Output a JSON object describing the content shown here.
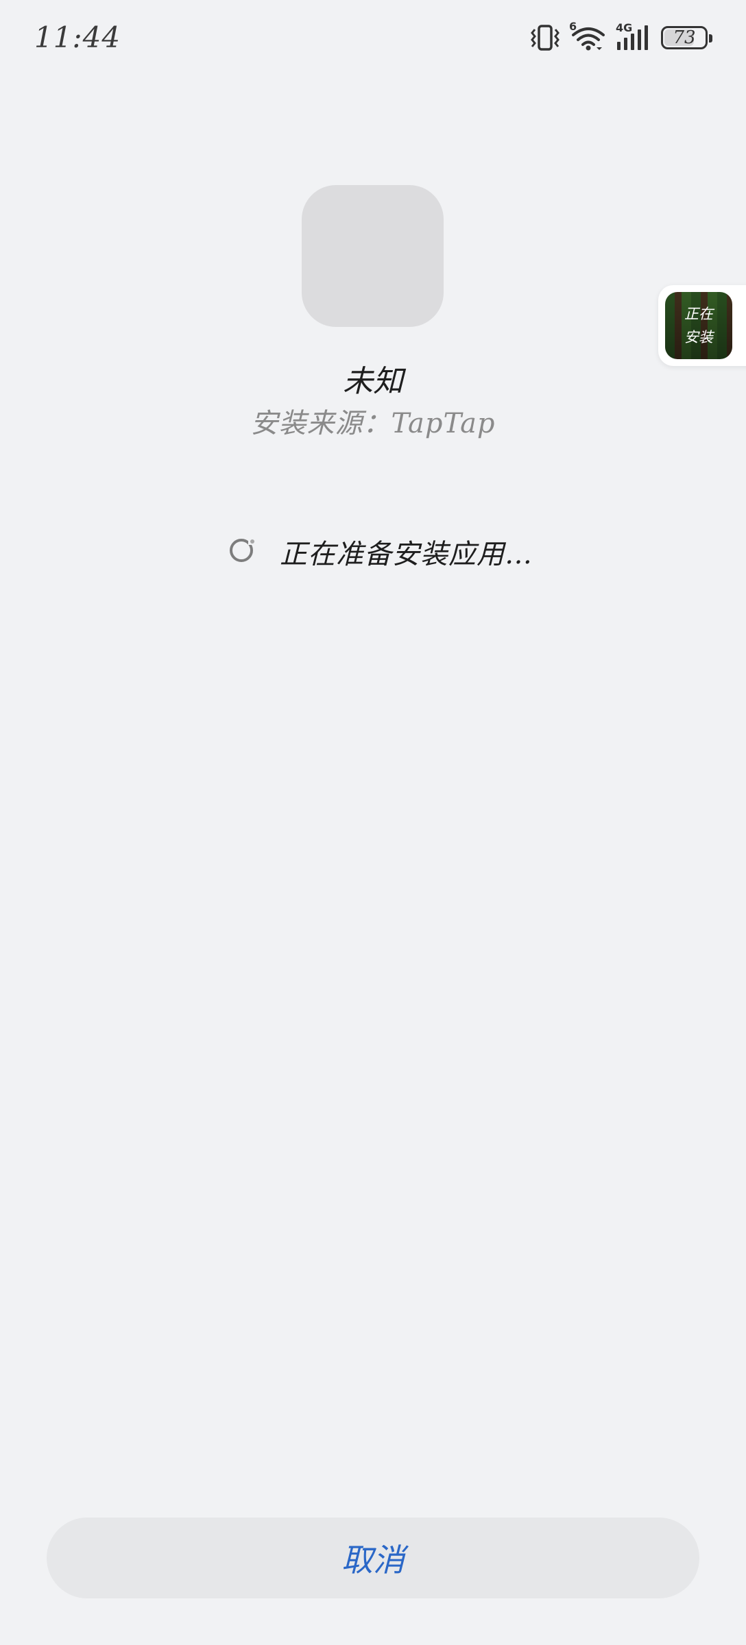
{
  "status_bar": {
    "time": "11:44",
    "network_type": "4G",
    "wifi_tag": "6",
    "battery_level": "73",
    "icons": [
      "vibrate-icon",
      "wifi-6-icon",
      "signal-4g-icon",
      "battery-icon"
    ]
  },
  "app": {
    "name": "未知",
    "install_source": "安装来源：TapTap"
  },
  "progress": {
    "message": "正在准备安装应用…"
  },
  "floating_badge": {
    "line1": "正在",
    "line2": "安装"
  },
  "actions": {
    "cancel_label": "取消"
  },
  "colors": {
    "background": "#f1f2f4",
    "accent": "#2a67c7",
    "button_bg": "#e6e7e9"
  }
}
